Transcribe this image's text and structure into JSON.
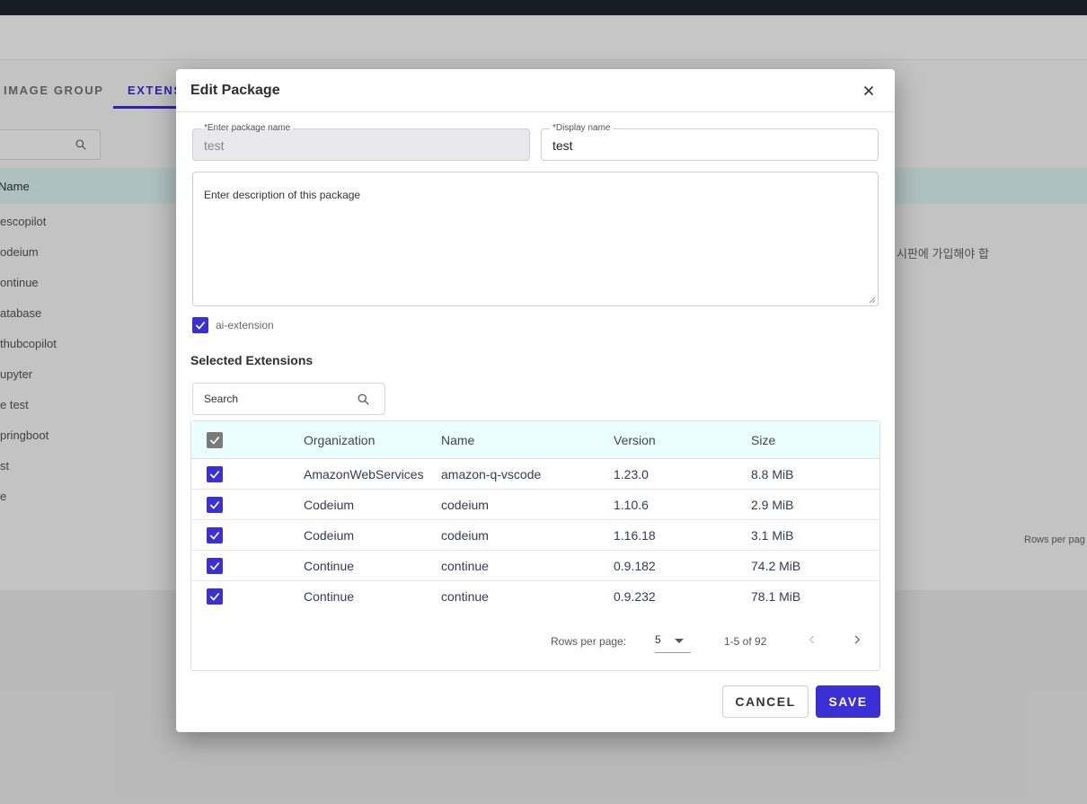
{
  "background": {
    "tabs": [
      {
        "label": "IMAGE GROUP"
      },
      {
        "label": "EXTENS"
      }
    ],
    "table_header": "Name",
    "rows": [
      "escopilot",
      "odeium",
      "ontinue",
      "atabase",
      "thubcopilot",
      "upyter",
      "e test",
      "pringboot",
      "st",
      "e"
    ],
    "korean_text": "시판에 가입해야 합",
    "rows_per_page": "Rows per pag"
  },
  "modal": {
    "title": "Edit Package",
    "package_name": {
      "label": "*Enter package name",
      "value": "test"
    },
    "display_name": {
      "label": "*Display name",
      "value": "test"
    },
    "description_placeholder": "Enter description of this package",
    "ai_extension_label": "ai-extension",
    "section_title": "Selected Extensions",
    "search_placeholder": "Search",
    "table": {
      "headers": {
        "organization": "Organization",
        "name": "Name",
        "version": "Version",
        "size": "Size"
      },
      "rows": [
        {
          "organization": "AmazonWebServices",
          "name": "amazon-q-vscode",
          "version": "1.23.0",
          "size": "8.8 MiB"
        },
        {
          "organization": "Codeium",
          "name": "codeium",
          "version": "1.10.6",
          "size": "2.9 MiB"
        },
        {
          "organization": "Codeium",
          "name": "codeium",
          "version": "1.16.18",
          "size": "3.1 MiB"
        },
        {
          "organization": "Continue",
          "name": "continue",
          "version": "0.9.182",
          "size": "74.2 MiB"
        },
        {
          "organization": "Continue",
          "name": "continue",
          "version": "0.9.232",
          "size": "78.1 MiB"
        }
      ]
    },
    "pagination": {
      "rows_per_page_label": "Rows per page:",
      "rows_per_page_value": "5",
      "range": "1-5 of 92"
    },
    "buttons": {
      "cancel": "CANCEL",
      "save": "SAVE"
    }
  },
  "colors": {
    "accent": "#3b2fd6",
    "table_header_bg": "#eaffff"
  }
}
